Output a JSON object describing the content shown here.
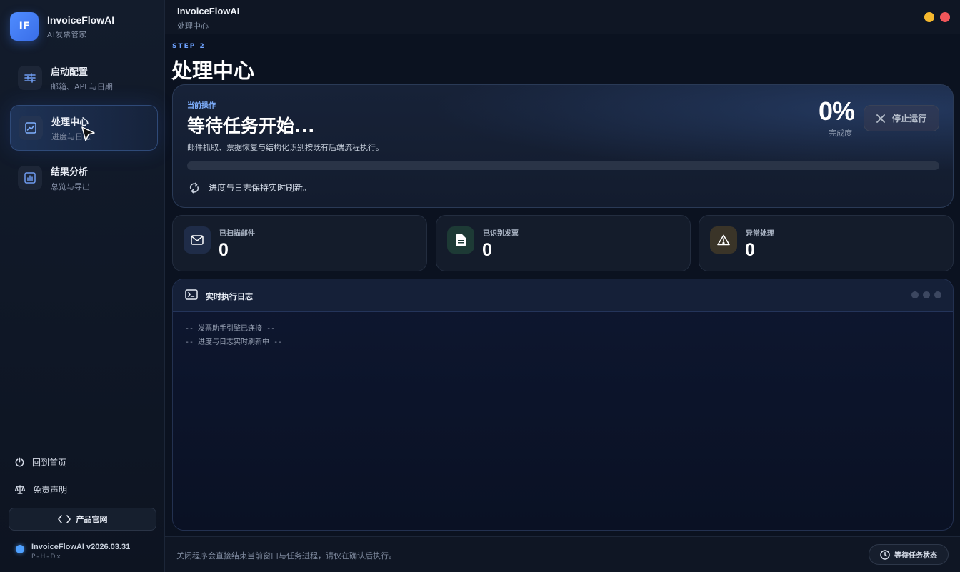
{
  "brand": {
    "logo": "IF",
    "name": "InvoiceFlowAI",
    "subtitle": "AI发票管家"
  },
  "nav": [
    {
      "id": "config",
      "title": "启动配置",
      "subtitle": "邮箱、API 与日期",
      "icon": "sliders-icon",
      "active": false
    },
    {
      "id": "process",
      "title": "处理中心",
      "subtitle": "进度与日志",
      "icon": "chart-line-icon",
      "active": true
    },
    {
      "id": "results",
      "title": "结果分析",
      "subtitle": "总览与导出",
      "icon": "bar-chart-icon",
      "active": false
    }
  ],
  "sidebar_links": {
    "home": "回到首页",
    "disclaimer": "免责声明"
  },
  "site_button": "产品官网",
  "version": {
    "name": "InvoiceFlowAI v2026.03.31",
    "author": "P-H-Dx"
  },
  "titlebar": {
    "title": "InvoiceFlowAI",
    "subtitle": "处理中心"
  },
  "page": {
    "step": "STEP 2",
    "title": "处理中心"
  },
  "operation": {
    "label": "当前操作",
    "title": "等待任务开始...",
    "description": "邮件抓取、票据恢复与结构化识别按既有后端流程执行。",
    "progress_percent": 0,
    "percent_text": "0%",
    "percent_label": "完成度",
    "refresh_note": "进度与日志保持实时刷新。",
    "stop_label": "停止运行"
  },
  "stats": [
    {
      "label": "已扫描邮件",
      "value": "0",
      "icon": "mail-icon",
      "color": "#8fb4ff"
    },
    {
      "label": "已识别发票",
      "value": "0",
      "icon": "document-icon",
      "color": "#7fd8b0"
    },
    {
      "label": "异常处理",
      "value": "0",
      "icon": "warning-icon",
      "color": "#f0d29a"
    }
  ],
  "log": {
    "title": "实时执行日志",
    "lines": [
      "-- 发票助手引擎已连接 --",
      "-- 进度与日志实时刷新中 --"
    ]
  },
  "footer": {
    "note": "关闭程序会直接结束当前窗口与任务进程，请仅在确认后执行。",
    "status_label": "等待任务状态"
  },
  "colors": {
    "accent": "#4f8cff",
    "minimize": "#f5b82e",
    "close": "#f0565a"
  }
}
